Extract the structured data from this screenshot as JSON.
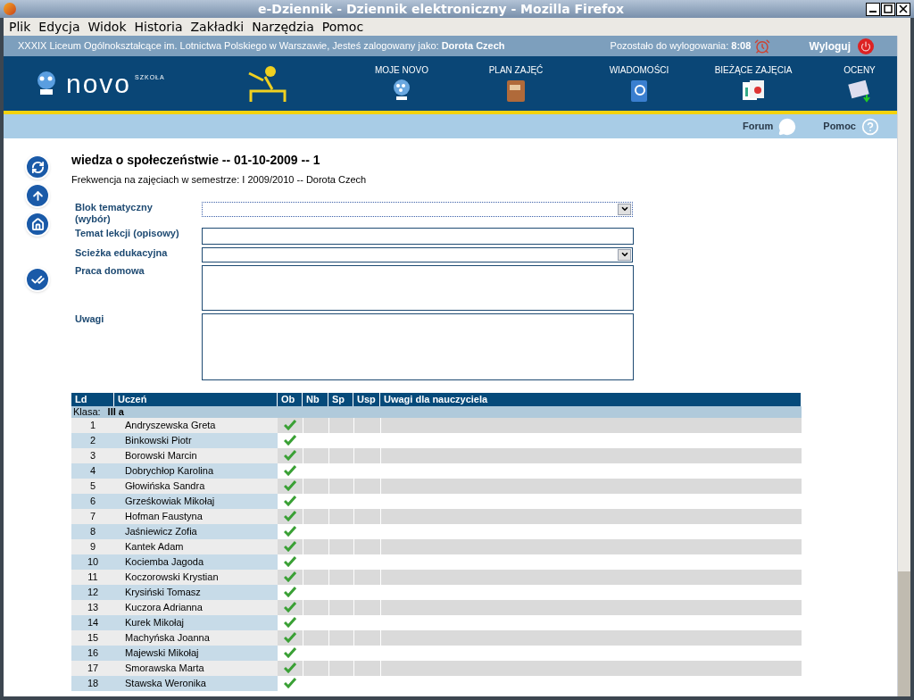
{
  "window": {
    "title": "e-Dziennik - Dziennik elektroniczny - Mozilla Firefox"
  },
  "menu": [
    "Plik",
    "Edycja",
    "Widok",
    "Historia",
    "Zakładki",
    "Narzędzia",
    "Pomoc"
  ],
  "info_bar": {
    "school": "XXXIX Liceum Ogólnokształcące im. Lotnictwa Polskiego w Warszawie, Jesteś zalogowany jako:",
    "user": "Dorota Czech",
    "timer_label": "Pozostało do wylogowania:",
    "timer": "8:08",
    "logout": "Wyloguj"
  },
  "logo": {
    "name": "novo",
    "sub": "SZKOŁA"
  },
  "nav": [
    "MOJE NOVO",
    "PLAN ZAJĘĆ",
    "WIADOMOŚCI",
    "BIEŻĄCE ZAJĘCIA",
    "OCENY"
  ],
  "sub_nav": [
    "Forum",
    "Pomoc"
  ],
  "heading": "wiedza o społeczeństwie -- 01-10-2009 -- 1",
  "subheading": "Frekwencja na zajęciach w semestrze: I 2009/2010 -- Dorota Czech",
  "form": [
    {
      "label": "Blok tematyczny (wybór)",
      "kind": "select",
      "focused": true
    },
    {
      "label": "Temat lekcji (opisowy)",
      "kind": "text",
      "focused": false
    },
    {
      "label": "Scieżka edukacyjna",
      "kind": "select",
      "focused": false
    },
    {
      "label": "Praca domowa",
      "kind": "area",
      "focused": false
    },
    {
      "label": "Uwagi",
      "kind": "area",
      "focused": false
    }
  ],
  "table": {
    "columns": [
      "Ld",
      "Uczeń",
      "Ob",
      "Nb",
      "Sp",
      "Usp",
      "Uwagi dla nauczyciela"
    ],
    "group_label": "Klasa:",
    "group": "III a",
    "rows": [
      {
        "ld": "1",
        "name": "Andryszewska Greta",
        "present": true
      },
      {
        "ld": "2",
        "name": "Binkowski Piotr",
        "present": true
      },
      {
        "ld": "3",
        "name": "Borowski Marcin",
        "present": true
      },
      {
        "ld": "4",
        "name": "Dobrychłop Karolina",
        "present": true
      },
      {
        "ld": "5",
        "name": "Głowińska Sandra",
        "present": true
      },
      {
        "ld": "6",
        "name": "Grześkowiak Mikołaj",
        "present": true
      },
      {
        "ld": "7",
        "name": "Hofman Faustyna",
        "present": true
      },
      {
        "ld": "8",
        "name": "Jaśniewicz Zofia",
        "present": true
      },
      {
        "ld": "9",
        "name": "Kantek Adam",
        "present": true
      },
      {
        "ld": "10",
        "name": "Kociemba Jagoda",
        "present": true
      },
      {
        "ld": "11",
        "name": "Koczorowski Krystian",
        "present": true
      },
      {
        "ld": "12",
        "name": "Krysiński Tomasz",
        "present": true
      },
      {
        "ld": "13",
        "name": "Kuczora Adrianna",
        "present": true
      },
      {
        "ld": "14",
        "name": "Kurek Mikołaj",
        "present": true
      },
      {
        "ld": "15",
        "name": "Machyńska Joanna",
        "present": true
      },
      {
        "ld": "16",
        "name": "Majewski Mikołaj",
        "present": true
      },
      {
        "ld": "17",
        "name": "Smorawska Marta",
        "present": true
      },
      {
        "ld": "18",
        "name": "Stawska Weronika",
        "present": true
      }
    ]
  }
}
